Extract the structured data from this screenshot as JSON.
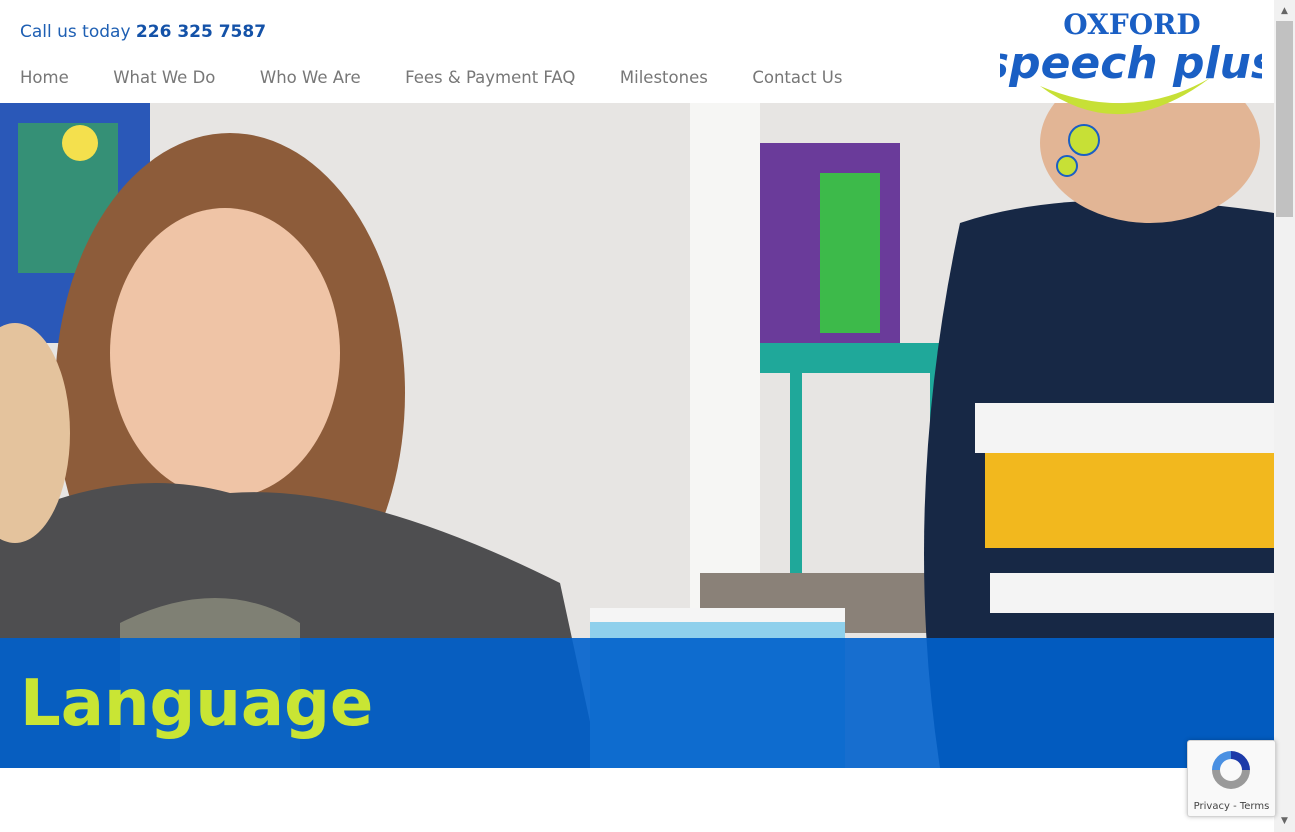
{
  "header": {
    "call_prefix": "Call us today",
    "phone": "226 325 7587"
  },
  "nav": {
    "items": [
      {
        "label": "Home"
      },
      {
        "label": "What We Do"
      },
      {
        "label": "Who We Are"
      },
      {
        "label": "Fees & Payment FAQ"
      },
      {
        "label": "Milestones"
      },
      {
        "label": "Contact Us"
      }
    ]
  },
  "logo": {
    "line1": "OXFORD",
    "line2": "speech plus",
    "colors": {
      "blue": "#1a5fc4",
      "green": "#c7e036"
    }
  },
  "hero": {
    "title": "Language",
    "band_color": "#0060cc",
    "title_color": "#c9e534"
  },
  "recaptcha": {
    "privacy": "Privacy",
    "separator": " - ",
    "terms": "Terms"
  }
}
